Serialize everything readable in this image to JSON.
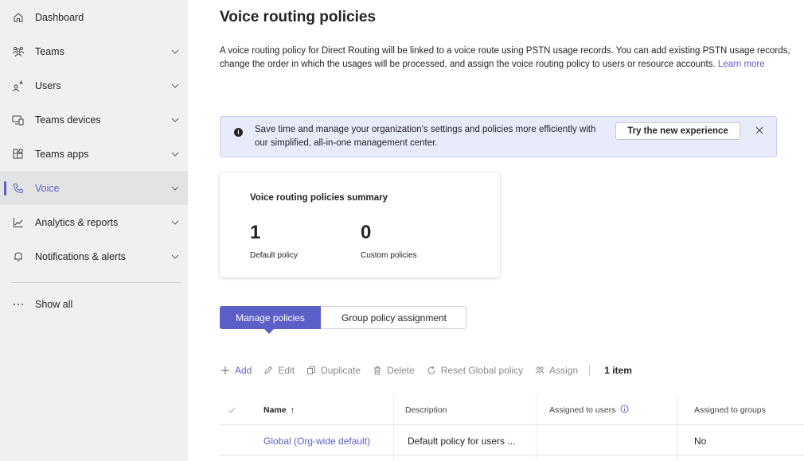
{
  "colors": {
    "accent": "#5b5fc7",
    "sidebar_bg": "#f0f0f0",
    "banner_bg": "#e8ebfa"
  },
  "sidebar": {
    "items": [
      {
        "label": "Dashboard",
        "icon": "home-icon",
        "has_chevron": false
      },
      {
        "label": "Teams",
        "icon": "teams-icon",
        "has_chevron": true
      },
      {
        "label": "Users",
        "icon": "users-icon",
        "has_chevron": true
      },
      {
        "label": "Teams devices",
        "icon": "devices-icon",
        "has_chevron": true
      },
      {
        "label": "Teams apps",
        "icon": "apps-icon",
        "has_chevron": true
      },
      {
        "label": "Voice",
        "icon": "phone-icon",
        "has_chevron": true,
        "selected": true
      },
      {
        "label": "Analytics & reports",
        "icon": "chart-line-icon",
        "has_chevron": true
      },
      {
        "label": "Notifications & alerts",
        "icon": "bell-icon",
        "has_chevron": true
      }
    ],
    "show_all": {
      "label": "Show all",
      "icon": "more-icon"
    }
  },
  "page": {
    "title": "Voice routing policies",
    "description": "A voice routing policy for Direct Routing will be linked to a voice route using PSTN usage records. You can add existing PSTN usage records, change the order in which the usages will be processed, and assign the voice routing policy to users or resource accounts.",
    "learn_more": "Learn more"
  },
  "banner": {
    "text": "Save time and manage your organization's settings and policies more efficiently with our simplified, all-in-one management center.",
    "button": "Try the new experience",
    "icon": "info-icon"
  },
  "summary": {
    "title": "Voice routing policies summary",
    "stats": [
      {
        "value": "1",
        "label": "Default policy"
      },
      {
        "value": "0",
        "label": "Custom policies"
      }
    ]
  },
  "tabs": [
    {
      "label": "Manage policies",
      "active": true
    },
    {
      "label": "Group policy assignment",
      "active": false
    }
  ],
  "toolbar": {
    "add": "Add",
    "edit": "Edit",
    "duplicate": "Duplicate",
    "delete": "Delete",
    "reset": "Reset Global policy",
    "assign": "Assign",
    "count": "1 item"
  },
  "table": {
    "columns": [
      "Name",
      "Description",
      "Assigned to users",
      "Assigned to groups"
    ],
    "sort_indicator": "↑",
    "rows": [
      {
        "name": "Global (Org-wide default)",
        "description": "Default policy for users ...",
        "assigned_users": "",
        "assigned_groups": "No"
      }
    ]
  }
}
